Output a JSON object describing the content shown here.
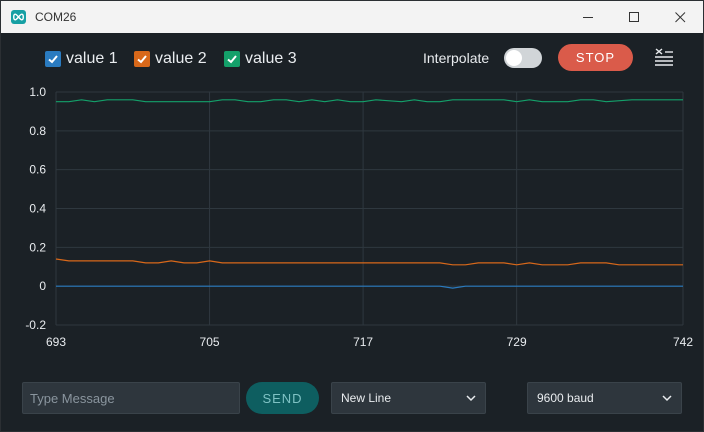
{
  "window": {
    "title": "COM26"
  },
  "legend": [
    {
      "label": "value 1",
      "color": "#2a7bc0",
      "checked": true
    },
    {
      "label": "value 2",
      "color": "#d8681a",
      "checked": true
    },
    {
      "label": "value 3",
      "color": "#14a06a",
      "checked": true
    }
  ],
  "controls": {
    "interpolate_label": "Interpolate",
    "interpolate_on": false,
    "stop_label": "STOP"
  },
  "chart_data": {
    "type": "line",
    "ylim": [
      -0.2,
      1.0
    ],
    "y_ticks": [
      "1.0",
      "0.8",
      "0.6",
      "0.4",
      "0.2",
      "0",
      "-0.2"
    ],
    "xlim": [
      693,
      742
    ],
    "x_ticks": [
      "693",
      "705",
      "717",
      "729",
      "742"
    ],
    "grid": true,
    "series": [
      {
        "name": "value 1",
        "color": "#2a7bc0",
        "x": [
          693,
          700,
          710,
          720,
          723,
          724,
          725,
          730,
          735,
          742
        ],
        "y": [
          0.0,
          0.0,
          0.0,
          0.0,
          0.0,
          -0.01,
          0.0,
          0.0,
          0.0,
          0.0
        ]
      },
      {
        "name": "value 2",
        "color": "#d8681a",
        "x": [
          693,
          694,
          696,
          699,
          700,
          701,
          702,
          703,
          704,
          705,
          706,
          710,
          715,
          720,
          723,
          724,
          725,
          726,
          727,
          728,
          729,
          730,
          731,
          732,
          733,
          734,
          735,
          736,
          737,
          738,
          740,
          742
        ],
        "y": [
          0.14,
          0.13,
          0.13,
          0.13,
          0.12,
          0.12,
          0.13,
          0.12,
          0.12,
          0.13,
          0.12,
          0.12,
          0.12,
          0.12,
          0.12,
          0.11,
          0.11,
          0.12,
          0.12,
          0.12,
          0.11,
          0.12,
          0.11,
          0.11,
          0.11,
          0.12,
          0.12,
          0.12,
          0.11,
          0.11,
          0.11,
          0.11
        ]
      },
      {
        "name": "value 3",
        "color": "#14a06a",
        "x": [
          693,
          694,
          695,
          696,
          697,
          699,
          700,
          701,
          705,
          706,
          707,
          708,
          709,
          710,
          711,
          712,
          713,
          714,
          715,
          716,
          717,
          718,
          720,
          721,
          722,
          723,
          724,
          725,
          728,
          729,
          730,
          731,
          733,
          734,
          735,
          736,
          738,
          742
        ],
        "y": [
          0.95,
          0.95,
          0.96,
          0.95,
          0.96,
          0.96,
          0.95,
          0.95,
          0.95,
          0.96,
          0.96,
          0.95,
          0.95,
          0.96,
          0.96,
          0.95,
          0.96,
          0.95,
          0.96,
          0.95,
          0.95,
          0.96,
          0.95,
          0.96,
          0.95,
          0.95,
          0.96,
          0.96,
          0.96,
          0.95,
          0.96,
          0.95,
          0.95,
          0.96,
          0.96,
          0.95,
          0.96,
          0.96
        ]
      }
    ]
  },
  "footer": {
    "message_placeholder": "Type Message",
    "send_label": "SEND",
    "line_ending": "New Line",
    "baud": "9600 baud"
  }
}
